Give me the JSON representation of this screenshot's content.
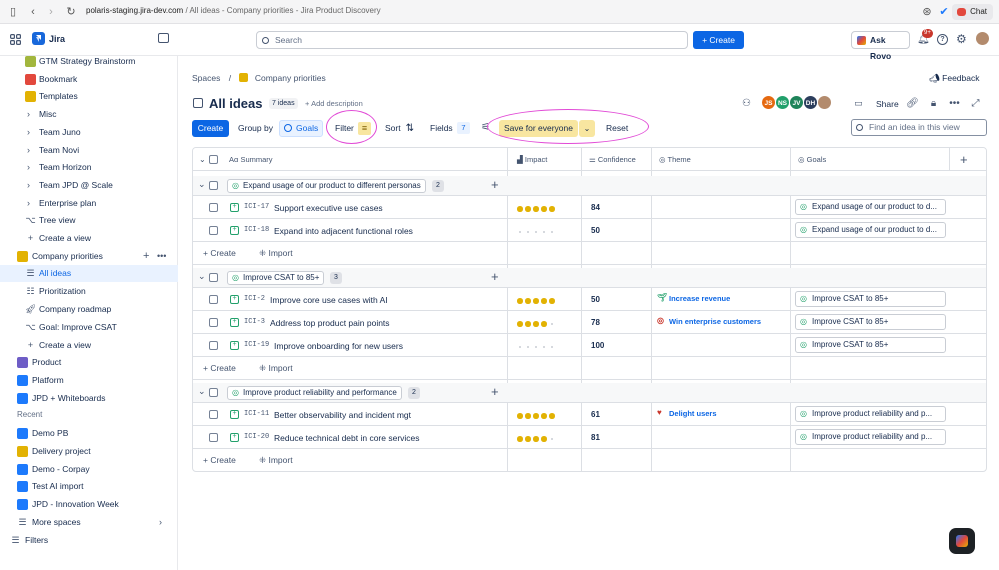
{
  "browser": {
    "url_host": "polaris-staging.jira-dev.com",
    "url_path": " / All ideas - Company priorities - Jira Product Discovery",
    "chat_label": "Chat"
  },
  "topnav": {
    "app_name": "Jira",
    "search_placeholder": "Search",
    "create_label": "Create",
    "ask_rovo_label": "Ask Rovo",
    "notif_badge": "9+"
  },
  "sidebar": {
    "items": [
      {
        "label": "GTM Strategy Brainstorm",
        "color": "#a2b63d"
      },
      {
        "label": "Bookmark",
        "color": "#e2483d"
      },
      {
        "label": "Templates",
        "color": "#e2b203"
      },
      {
        "label": "Misc"
      },
      {
        "label": "Team Juno"
      },
      {
        "label": "Team Novi"
      },
      {
        "label": "Team Horizon"
      },
      {
        "label": "Team JPD @ Scale"
      },
      {
        "label": "Enterprise plan"
      },
      {
        "label": "Tree view"
      },
      {
        "label": "Create a view"
      }
    ],
    "project": "Company priorities",
    "project_views": [
      {
        "label": "All ideas"
      },
      {
        "label": "Prioritization"
      },
      {
        "label": "Company roadmap"
      },
      {
        "label": "Goal: Improve CSAT"
      },
      {
        "label": "Create a view"
      }
    ],
    "spaces": [
      {
        "label": "Product",
        "color": "#6e5dc6"
      },
      {
        "label": "Platform",
        "color": "#1d7afc"
      },
      {
        "label": "JPD + Whiteboards",
        "color": "#1d7afc"
      }
    ],
    "recent_heading": "Recent",
    "recent": [
      {
        "label": "Demo PB",
        "color": "#1d7afc"
      },
      {
        "label": "Delivery project",
        "color": "#e2b203"
      },
      {
        "label": "Demo - Corpay",
        "color": "#1d7afc"
      },
      {
        "label": "Test AI import",
        "color": "#1d7afc"
      },
      {
        "label": "JPD - Innovation Week",
        "color": "#1d7afc"
      }
    ],
    "more_spaces": "More spaces",
    "filters": "Filters"
  },
  "main": {
    "breadcrumb_root": "Spaces",
    "breadcrumb_project": "Company priorities",
    "feedback_label": "Feedback",
    "title": "All ideas",
    "idea_count": "7 ideas",
    "add_description": "Add description",
    "share_label": "Share",
    "avatars": [
      {
        "initials": "JS",
        "color": "#e56910"
      },
      {
        "initials": "NS",
        "color": "#22a06b"
      },
      {
        "initials": "JV",
        "color": "#1f845a"
      },
      {
        "initials": "DH",
        "color": "#2c3e5d"
      },
      {
        "initials": "",
        "color": "#b38b6d"
      }
    ],
    "toolbar": {
      "create": "Create",
      "group_by": "Group by",
      "group_value": "Goals",
      "filter": "Filter",
      "sort": "Sort",
      "fields": "Fields",
      "fields_count": "7",
      "save_everyone": "Save for everyone",
      "reset": "Reset",
      "find_placeholder": "Find an idea in this view"
    },
    "columns": {
      "summary": "Summary",
      "impact": "Impact",
      "confidence": "Confidence",
      "theme": "Theme",
      "goals": "Goals"
    },
    "add_create": "Create",
    "add_import": "Import",
    "groups": [
      {
        "label": "Expand usage of our product to different personas",
        "count": "2",
        "rows": [
          {
            "key": "ICI-17",
            "summary": "Support executive use cases",
            "impact": 5,
            "confidence": "84",
            "theme": "",
            "theme_icon": "",
            "goal": "Expand usage of our product to d..."
          },
          {
            "key": "ICI-18",
            "summary": "Expand into adjacent functional roles",
            "impact": 0,
            "confidence": "50",
            "theme": "",
            "theme_icon": "",
            "goal": "Expand usage of our product to d..."
          }
        ]
      },
      {
        "label": "Improve CSAT to 85+",
        "count": "3",
        "rows": [
          {
            "key": "ICI-2",
            "summary": "Improve core use cases with AI",
            "impact": 5,
            "confidence": "50",
            "theme": "Increase revenue",
            "theme_icon": "sprout-icon",
            "goal": "Improve CSAT to 85+"
          },
          {
            "key": "ICI-3",
            "summary": "Address top product pain points",
            "impact": 4,
            "confidence": "78",
            "theme": "Win enterprise customers",
            "theme_icon": "target-icon",
            "goal": "Improve CSAT to 85+"
          },
          {
            "key": "ICI-19",
            "summary": "Improve onboarding for new users",
            "impact": 0,
            "confidence": "100",
            "theme": "",
            "theme_icon": "",
            "goal": "Improve CSAT to 85+"
          }
        ]
      },
      {
        "label": "Improve product reliability and performance",
        "count": "2",
        "rows": [
          {
            "key": "ICI-11",
            "summary": "Better observability and incident mgt",
            "impact": 5,
            "confidence": "61",
            "theme": "Delight users",
            "theme_icon": "heart-icon",
            "goal": "Improve product reliability and p..."
          },
          {
            "key": "ICI-20",
            "summary": "Reduce technical debt in core services",
            "impact": 4,
            "confidence": "81",
            "theme": "",
            "theme_icon": "",
            "goal": "Improve product reliability and p..."
          }
        ]
      }
    ]
  },
  "colors": {
    "accent": "#0c66e4",
    "highlight_ring": "#e14ad6",
    "star": "#e2b203",
    "save_bg": "#f8e6a0"
  }
}
